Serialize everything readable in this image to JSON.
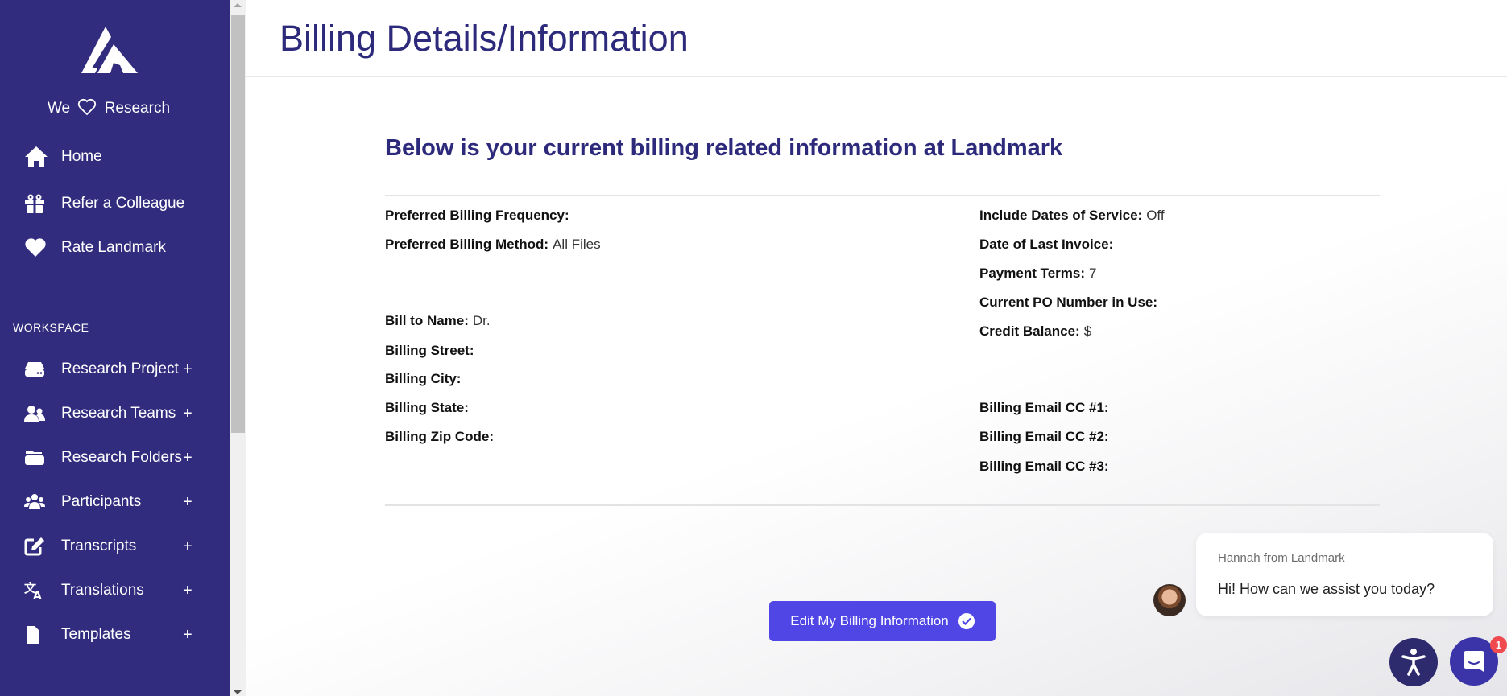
{
  "sidebar": {
    "tagline_pre": "We",
    "tagline_post": "Research",
    "top_items": [
      {
        "label": "Home",
        "icon": "home-icon"
      },
      {
        "label": "Refer a Colleague",
        "icon": "gift-icon"
      },
      {
        "label": "Rate Landmark",
        "icon": "heart-icon"
      }
    ],
    "workspace_label": "WORKSPACE",
    "workspace_items": [
      {
        "label": "Research Project",
        "icon": "hdd-icon",
        "action": "+"
      },
      {
        "label": "Research Teams",
        "icon": "users-icon",
        "action": "+"
      },
      {
        "label": "Research Folders",
        "icon": "folder-icon",
        "action": "+"
      },
      {
        "label": "Participants",
        "icon": "group-icon",
        "action": "+"
      },
      {
        "label": "Transcripts",
        "icon": "edit-icon",
        "action": "+"
      },
      {
        "label": "Translations",
        "icon": "language-icon",
        "action": "+"
      },
      {
        "label": "Templates",
        "icon": "file-icon",
        "action": "+"
      }
    ]
  },
  "header": {
    "title": "Billing Details/Information"
  },
  "billing": {
    "heading": "Below is your current billing related information at Landmark",
    "left_fields": [
      {
        "label": "Preferred Billing Frequency:",
        "value": ""
      },
      {
        "label": "Preferred Billing Method:",
        "value": "All Files"
      },
      {
        "label": "Bill to Name:",
        "value": "Dr."
      },
      {
        "label": "Billing Street:",
        "value": ""
      },
      {
        "label": "Billing City:",
        "value": ""
      },
      {
        "label": "Billing State:",
        "value": ""
      },
      {
        "label": "Billing Zip Code:",
        "value": ""
      }
    ],
    "right_fields": [
      {
        "label": "Include Dates of Service:",
        "value": "Off"
      },
      {
        "label": "Date of Last Invoice:",
        "value": ""
      },
      {
        "label": "Payment Terms:",
        "value": "7"
      },
      {
        "label": "Current PO Number in Use:",
        "value": ""
      },
      {
        "label": "Credit Balance:",
        "value": "$"
      },
      {
        "label": "Billing Email CC #1:",
        "value": ""
      },
      {
        "label": "Billing Email CC #2:",
        "value": ""
      },
      {
        "label": "Billing Email CC #3:",
        "value": ""
      }
    ],
    "edit_button_label": "Edit My Billing Information"
  },
  "chat": {
    "sender": "Hannah from Landmark",
    "message": "Hi! How can we assist you today?",
    "unread_count": "1"
  },
  "colors": {
    "sidebar_bg": "#322c7e",
    "title": "#2d2a7c",
    "button": "#4f46e5",
    "badge": "#f04a4f"
  }
}
